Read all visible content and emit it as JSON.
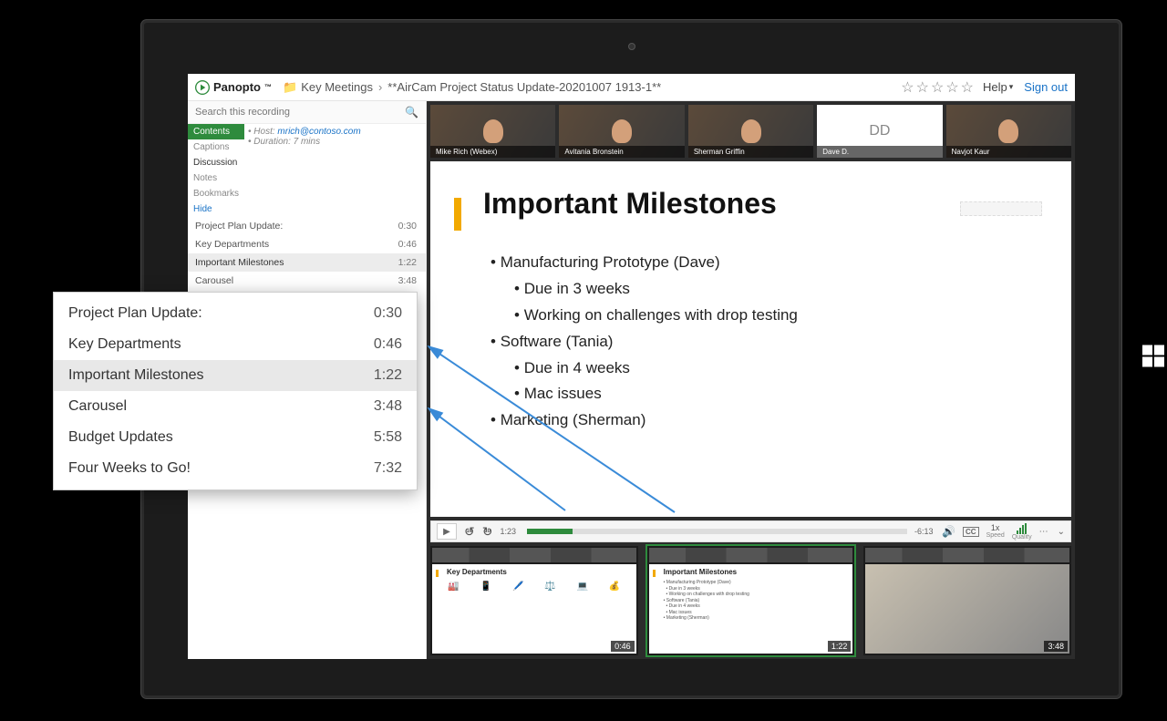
{
  "brand": "Panopto",
  "breadcrumb_folder": "Key Meetings",
  "title": "**AirCam Project Status Update-20201007 1913-1**",
  "help": "Help",
  "signout": "Sign out",
  "search_placeholder": "Search this recording",
  "left_tabs": {
    "contents": "Contents",
    "captions": "Captions",
    "discussion": "Discussion",
    "notes": "Notes",
    "bookmarks": "Bookmarks",
    "hide": "Hide"
  },
  "meta": {
    "host_label": "Host:",
    "host_email": "mrich@contoso.com",
    "duration_label": "Duration: 7 mins"
  },
  "chapters": [
    {
      "label": "Project Plan Update:",
      "time": "0:30"
    },
    {
      "label": "Key Departments",
      "time": "0:46"
    },
    {
      "label": "Important Milestones",
      "time": "1:22"
    },
    {
      "label": "Carousel",
      "time": "3:48"
    },
    {
      "label": "Budget Updates",
      "time": "5:58"
    },
    {
      "label": "Four Weeks to Go!",
      "time": "7:32"
    }
  ],
  "participants": [
    {
      "name": "Mike Rich (Webex)"
    },
    {
      "name": "Avitania Bronstein"
    },
    {
      "name": "Sherman Griffin"
    },
    {
      "name": "Dave D.",
      "initials": "DD"
    },
    {
      "name": "Navjot Kaur"
    }
  ],
  "slide": {
    "title": "Important Milestones",
    "b1": "Manufacturing Prototype (Dave)",
    "b1a": "Due in 3 weeks",
    "b1b": "Working on challenges with drop testing",
    "b2": "Software (Tania)",
    "b2a": "Due in 4 weeks",
    "b2b": "Mac issues",
    "b3": "Marketing (Sherman)"
  },
  "player": {
    "current": "1:23",
    "remaining": "-6:13",
    "speed": "1x",
    "speed_label": "Speed",
    "quality_label": "Quality",
    "cc": "CC"
  },
  "thumbs": [
    {
      "title": "Key Departments",
      "time": "0:46"
    },
    {
      "title": "Important Milestones",
      "time": "1:22"
    },
    {
      "title": "",
      "time": "3:48"
    }
  ],
  "callout_chapters": [
    {
      "label": "Project Plan Update:",
      "time": "0:30"
    },
    {
      "label": "Key Departments",
      "time": "0:46"
    },
    {
      "label": "Important Milestones",
      "time": "1:22"
    },
    {
      "label": "Carousel",
      "time": "3:48"
    },
    {
      "label": "Budget Updates",
      "time": "5:58"
    },
    {
      "label": "Four Weeks to Go!",
      "time": "7:32"
    }
  ]
}
